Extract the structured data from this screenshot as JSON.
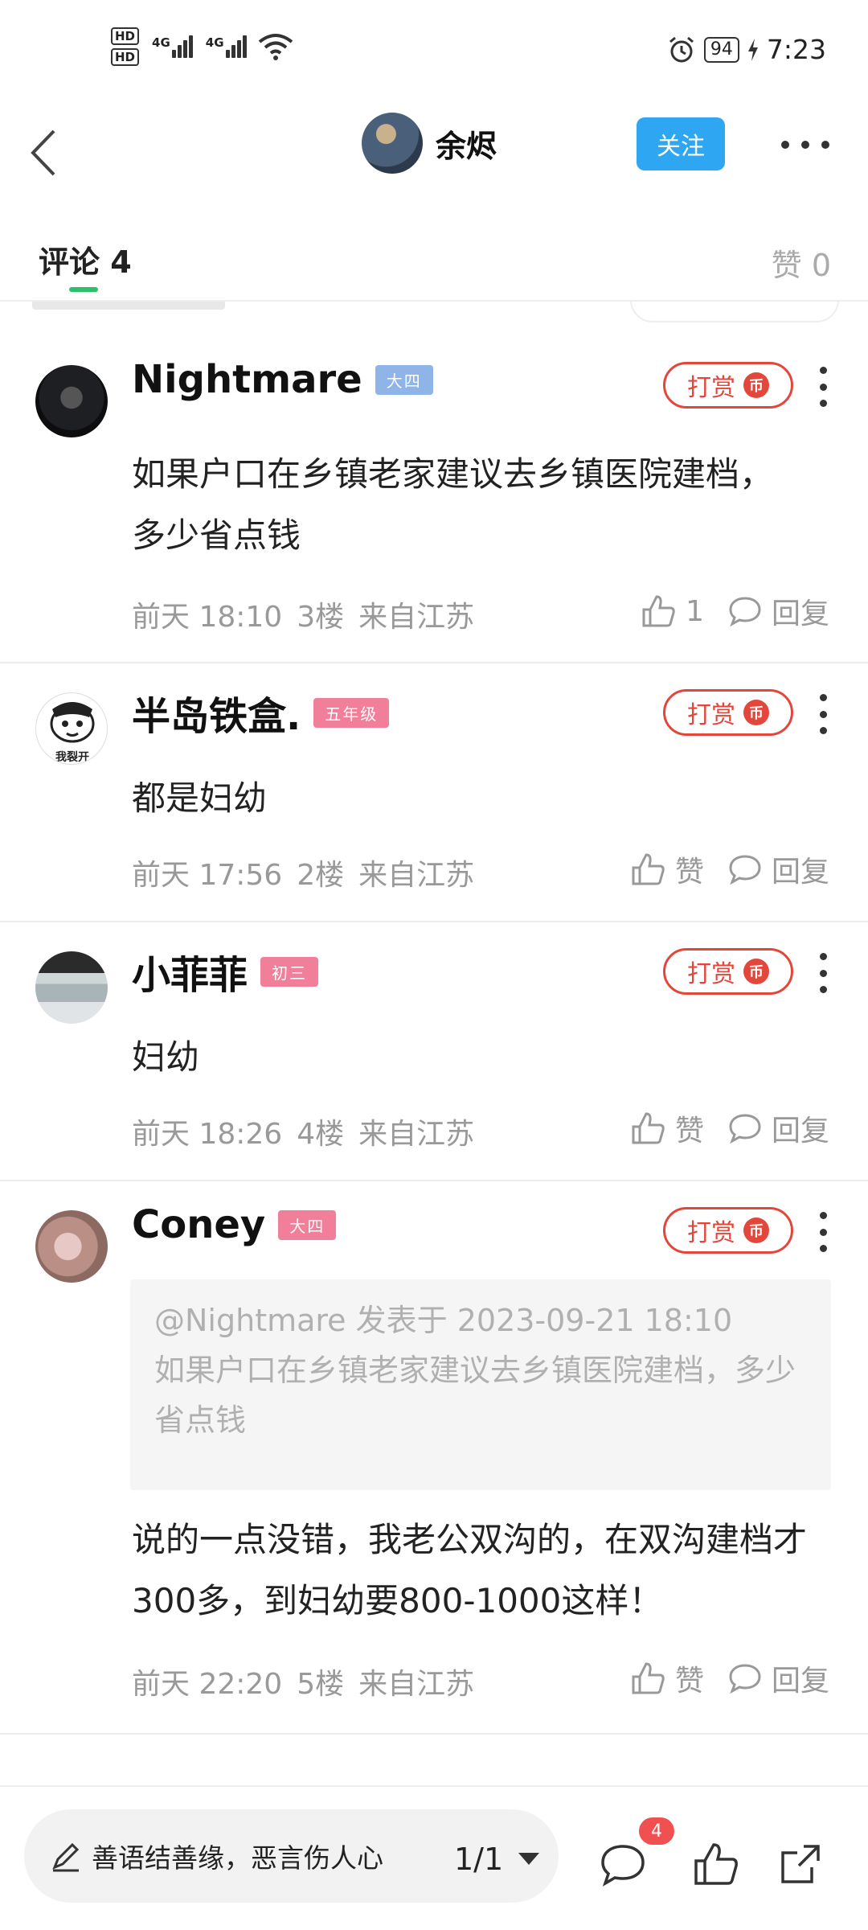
{
  "status_bar": {
    "hd1": "HD",
    "hd2": "HD",
    "net1": "4G",
    "net2": "4G",
    "battery": "94",
    "time": "7:23"
  },
  "header": {
    "user_name": "余烬",
    "follow_label": "关注"
  },
  "tabs": {
    "comments_label": "评论 4",
    "likes_label": "赞 0"
  },
  "comments": [
    {
      "name": "Nightmare",
      "badge": "大四",
      "badge_color": "#8fb4e8",
      "tip_label": "打赏",
      "tip_coin": "币",
      "text": "如果户口在乡镇老家建议去乡镇医院建档，多少省点钱",
      "time": "前天 18:10",
      "floor": "3楼",
      "location": "来自江苏",
      "like_label": "1",
      "reply_label": "回复"
    },
    {
      "name": "半岛铁盒.",
      "badge": "五年级",
      "badge_color": "#f27f9a",
      "tip_label": "打赏",
      "tip_coin": "币",
      "avatar_text": "我裂开",
      "text": "都是妇幼",
      "time": "前天 17:56",
      "floor": "2楼",
      "location": "来自江苏",
      "like_label": "赞",
      "reply_label": "回复"
    },
    {
      "name": "小菲菲",
      "badge": "初三",
      "badge_color": "#f27f9a",
      "tip_label": "打赏",
      "tip_coin": "币",
      "text": "妇幼",
      "time": "前天 18:26",
      "floor": "4楼",
      "location": "来自江苏",
      "like_label": "赞",
      "reply_label": "回复"
    },
    {
      "name": "Coney",
      "badge": "大四",
      "badge_color": "#f27f9a",
      "tip_label": "打赏",
      "tip_coin": "币",
      "quote_header": "@Nightmare 发表于 2023-09-21 18:10",
      "quote_text": "如果户口在乡镇老家建议去乡镇医院建档，多少省点钱",
      "text": "说的一点没错，我老公双沟的，在双沟建档才300多，到妇幼要800-1000这样！",
      "time": "前天 22:20",
      "floor": "5楼",
      "location": "来自江苏",
      "like_label": "赞",
      "reply_label": "回复"
    }
  ],
  "bottom_bar": {
    "input_placeholder": "善语结善缘，恶言伤人心",
    "page_indicator": "1/1",
    "comment_count_badge": "4"
  },
  "icons": [
    "back-icon",
    "more-icon",
    "pen-icon",
    "comment-icon",
    "thumbs-up-icon",
    "share-icon",
    "alarm-icon",
    "wifi-icon"
  ]
}
